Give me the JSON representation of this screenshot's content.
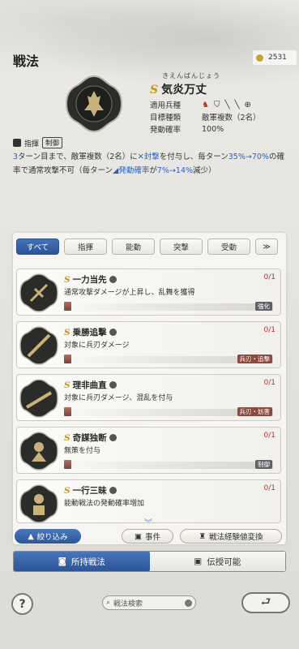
{
  "header": {
    "title": "戦法",
    "points": "2531"
  },
  "selected_skill": {
    "reading": "きえんばんじょう",
    "grade": "S",
    "name": "気炎万丈",
    "stats": [
      {
        "key": "適用兵種",
        "value": ""
      },
      {
        "key": "目標種類",
        "value": "敵軍複数（2名）"
      },
      {
        "key": "発動確率",
        "value": "100%"
      }
    ],
    "tags": [
      "指揮",
      "制御"
    ],
    "description_parts": [
      "3",
      "ターン目まで、敵軍複数（2名）に",
      "封撃",
      "を付与し、毎ターン",
      "35%→70%",
      "の確率で通常攻撃不可（毎ターン",
      "発動確率",
      "が",
      "7%→14%",
      "減少）"
    ]
  },
  "tabs": [
    {
      "label": "すべて",
      "active": true
    },
    {
      "label": "指揮",
      "active": false
    },
    {
      "label": "能動",
      "active": false
    },
    {
      "label": "突撃",
      "active": false
    },
    {
      "label": "受動",
      "active": false
    },
    {
      "label": "≫",
      "active": false
    }
  ],
  "skill_list": [
    {
      "grade": "S",
      "name": "一力当先",
      "effect": "通常攻撃ダメージが上昇し、乱舞を獲得",
      "count": "0/1",
      "badge": "強化"
    },
    {
      "grade": "S",
      "name": "乗勝追撃",
      "effect": "対象に兵刃ダメージ",
      "count": "0/1",
      "badge": "兵刃・追撃"
    },
    {
      "grade": "S",
      "name": "理非曲直",
      "effect": "対象に兵刃ダメージ、混乱を付与",
      "count": "0/1",
      "badge": "兵刃・妨害"
    },
    {
      "grade": "S",
      "name": "奇謀独断",
      "effect": "無策を付与",
      "count": "0/1",
      "badge": "制御"
    },
    {
      "grade": "S",
      "name": "一行三昧",
      "effect": "能動戦法の発動確率増加",
      "count": "0/1",
      "badge": ""
    }
  ],
  "controls": {
    "filter_label": "絞り込み",
    "event_label": "事件",
    "convert_label": "戦法経験値変換",
    "owned_label": "所持戦法",
    "transfer_label": "伝授可能",
    "search_placeholder": "戦法検索"
  }
}
